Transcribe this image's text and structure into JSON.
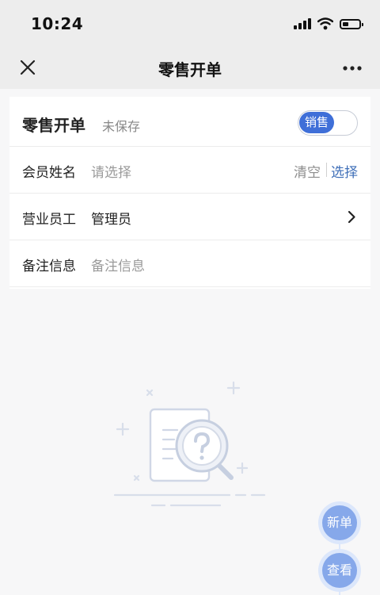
{
  "status_bar": {
    "time": "10:24"
  },
  "nav": {
    "title": "零售开单"
  },
  "form": {
    "title": "零售开单",
    "save_status": "未保存",
    "mode_toggle_label": "销售",
    "member": {
      "label": "会员姓名",
      "placeholder": "请选择",
      "clear_label": "清空",
      "select_label": "选择"
    },
    "staff": {
      "label": "营业员工",
      "value": "管理员"
    },
    "remark": {
      "label": "备注信息",
      "placeholder": "备注信息"
    }
  },
  "fab": {
    "new_label": "新单",
    "view_label": "查看"
  },
  "colors": {
    "accent": "#3f6fd8",
    "link": "#3f6fb8",
    "fab": "#86a8ea"
  },
  "icons": [
    "close-icon",
    "more-icon",
    "chevron-right-icon",
    "wifi-icon",
    "battery-icon",
    "signal-icon",
    "empty-search-icon"
  ]
}
